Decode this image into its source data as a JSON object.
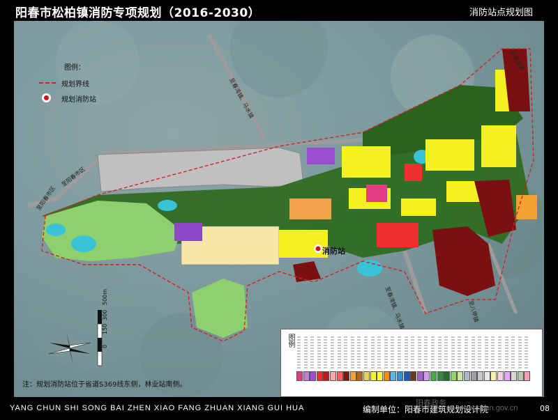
{
  "header": {
    "title": "阳春市松柏镇消防专项规划（2016-2030）",
    "sheet_name": "消防站点规划图"
  },
  "legend_top_left": {
    "heading": "图例：",
    "items": [
      {
        "label": "规划界线",
        "swatch": "boundary",
        "color": "#d42020"
      },
      {
        "label": "规划消防站",
        "swatch": "station",
        "color": "#d0101a"
      }
    ]
  },
  "map": {
    "station_label": "消防站",
    "road_labels": {
      "north_road": "至春湾镇、马水镇",
      "south_road": "至春湾镇、马水镇",
      "west_road": "至阳春市区",
      "east_road": "至双滘镇",
      "southeast_road": "至八甲镇",
      "northwest_road": "至阳春市区"
    }
  },
  "landuse_legend": {
    "heading": "图例",
    "colors": [
      "#e23c82",
      "#c47ad8",
      "#9b4dcf",
      "#f03030",
      "#c01818",
      "#fca8a8",
      "#ff6060",
      "#8a1010",
      "#f5a032",
      "#b4661e",
      "#e8d060",
      "#f7f03c",
      "#fbff2c",
      "#ff8c00",
      "#5ab4e6",
      "#2f8fd6",
      "#1e5bb4",
      "#6b3d1e",
      "#a45fcf",
      "#d09be8",
      "#49a84c",
      "#2e8b3c",
      "#1f6f2a",
      "#96d26a",
      "#c8e6a0",
      "#aab8c8",
      "#9aa0a6",
      "#c8c8c8",
      "#e8e8e8",
      "#f4f4b0",
      "#ffd0e0",
      "#e6a8ff",
      "#d8d8d8",
      "#b8c8a8",
      "#f0a0b0"
    ]
  },
  "scale_bar": {
    "labels": [
      "0",
      "150",
      "300",
      "500m"
    ]
  },
  "note": "注：规划消防站位于省道S369线东侧，林业站南侧。",
  "footer": {
    "pinyin": "YANG CHUN SHI SONG BAI ZHEN XIAO FANG ZHUAN XIANG GUI HUA",
    "maker": "编制单位：阳春市建筑规划设计院",
    "page_number": "08",
    "watermark_cn": "阳春政务",
    "watermark_url": "yangchun.gov.cn"
  }
}
